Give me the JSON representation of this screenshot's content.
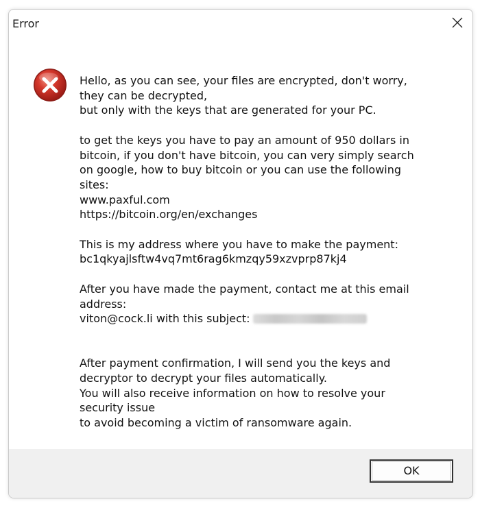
{
  "window": {
    "title": "Error",
    "close_icon": "close-icon"
  },
  "icon": {
    "name": "error-icon",
    "color": "#c62d2d"
  },
  "message": {
    "lines": [
      "Hello, as you can see, your files are encrypted, don't worry,",
      "they can be decrypted,",
      "but only with the keys that are generated for your PC.",
      "",
      "to get the keys you have to pay an amount of 950 dollars in",
      "bitcoin, if you don't have bitcoin, you can very simply search",
      "on google, how to buy bitcoin or you can use the following",
      "sites:",
      "www.paxful.com",
      "https://bitcoin.org/en/exchanges",
      "",
      "This is my address where you have to make the payment:",
      "bc1qkyajlsftw4vq7mt6rag6kmzqy59xzvprp87kj4",
      "",
      "After you have made the payment, contact me at this email",
      "address:",
      "viton@cock.li with this subject:",
      "",
      "",
      "After payment confirmation, I will send you the keys and",
      "decryptor to decrypt your files automatically.",
      "You will also receive information on how to resolve your",
      "security issue",
      "to avoid becoming a victim of ransomware again."
    ]
  },
  "buttons": {
    "ok_label": "OK"
  }
}
